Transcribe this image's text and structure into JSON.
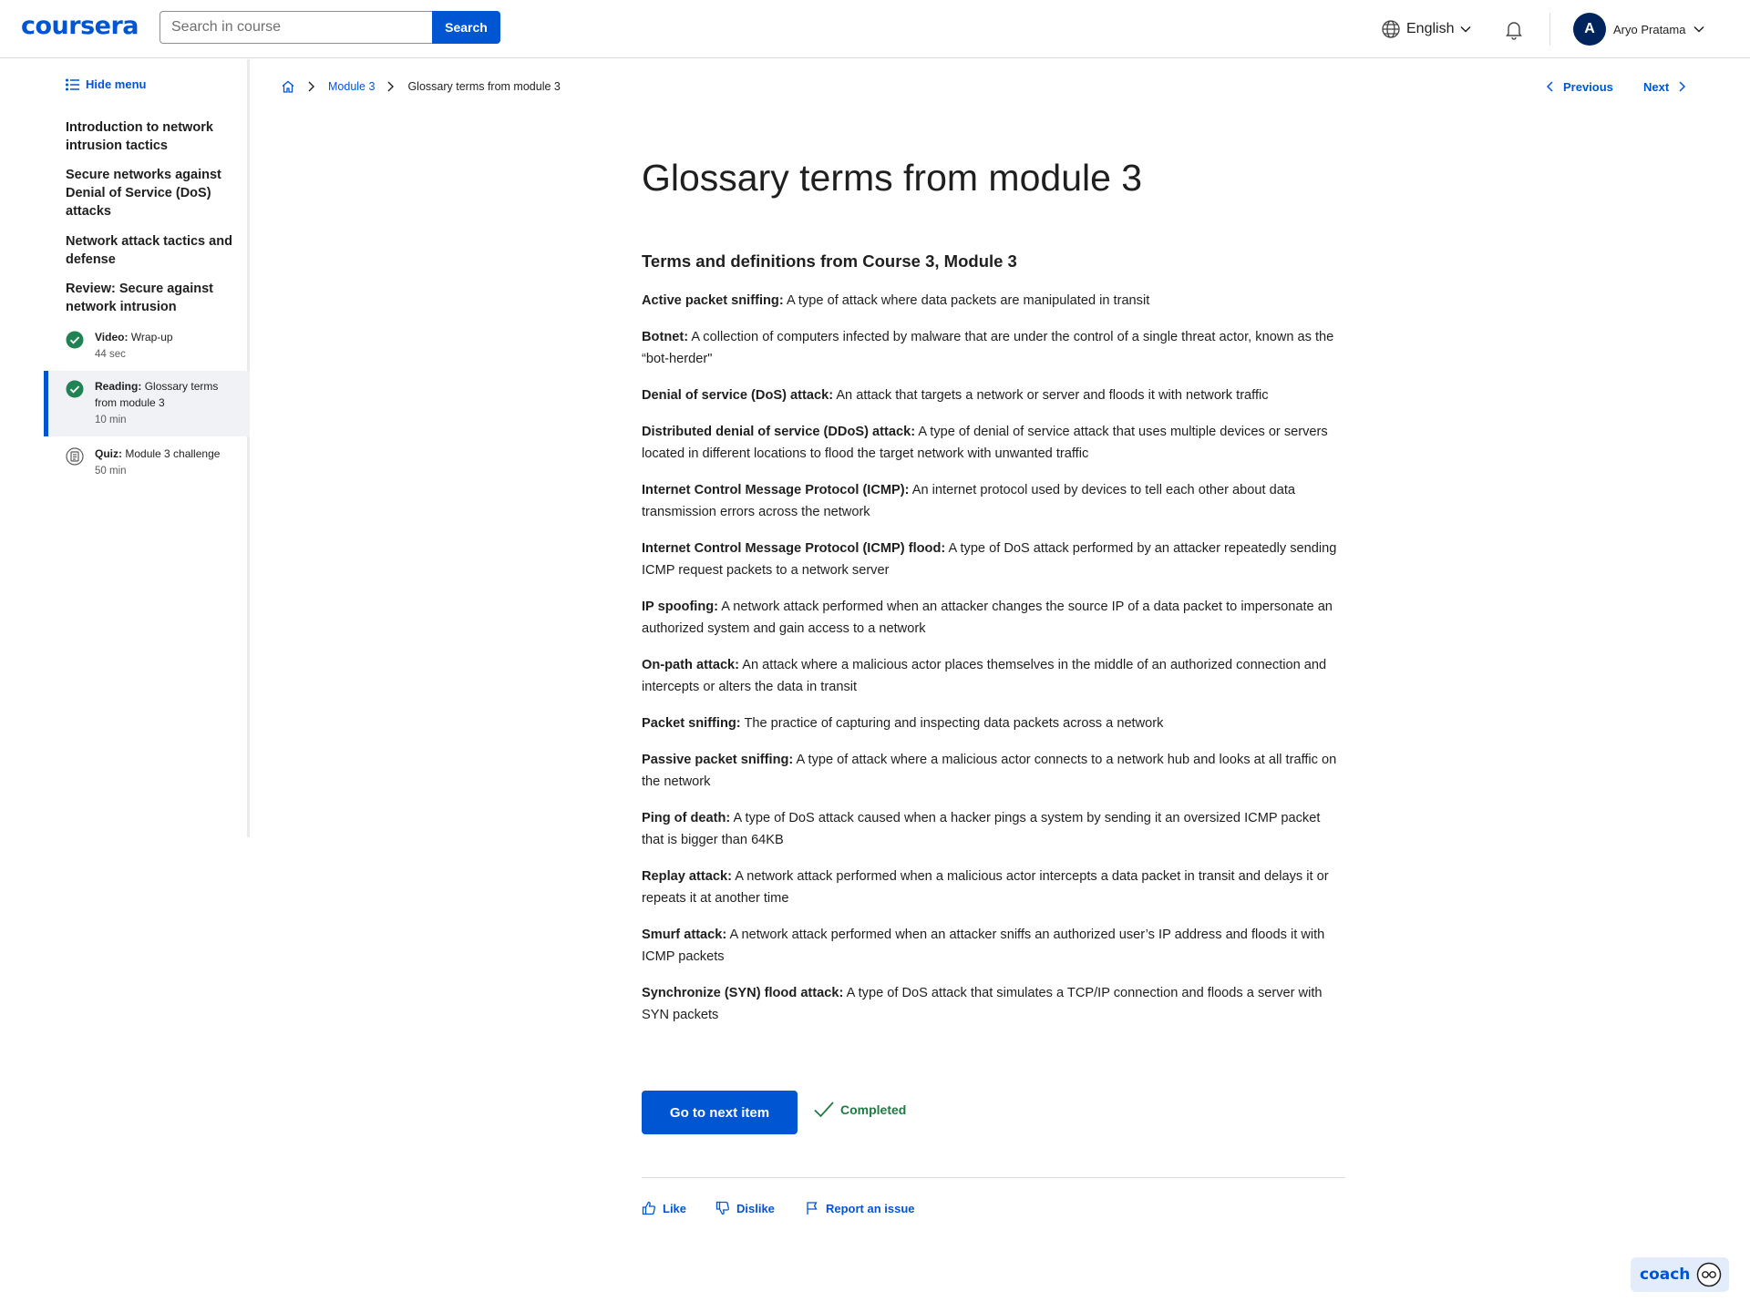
{
  "header": {
    "logo": "coursera",
    "search_placeholder": "Search in course",
    "search_button": "Search",
    "language": "English",
    "user_initial": "A",
    "user_name": "Aryo Pratama"
  },
  "sidebar": {
    "hide_menu": "Hide menu",
    "sections": [
      "Introduction to network intrusion tactics",
      "Secure networks against Denial of Service (DoS) attacks",
      "Network attack tactics and defense",
      "Review: Secure against network intrusion"
    ],
    "items": [
      {
        "type": "Video:",
        "title": "Wrap-up",
        "duration": "44 sec",
        "status": "completed"
      },
      {
        "type": "Reading:",
        "title": "Glossary terms from module 3",
        "duration": "10 min",
        "status": "completed"
      },
      {
        "type": "Quiz:",
        "title": "Module 3 challenge",
        "duration": "50 min",
        "status": "quiz"
      }
    ]
  },
  "breadcrumb": {
    "module": "Module 3",
    "current": "Glossary terms from module 3"
  },
  "nav": {
    "previous": "Previous",
    "next": "Next"
  },
  "main": {
    "title": "Glossary terms from module 3",
    "subtitle": "Terms and definitions from Course 3, Module 3",
    "terms": [
      {
        "term": "Active packet sniffing:",
        "def": "A type of attack where data packets are manipulated in transit"
      },
      {
        "term": "Botnet:",
        "def": "A collection of computers infected by malware that are under the control of a single threat actor, known as the “bot-herder\""
      },
      {
        "term": "Denial of service (DoS) attack:",
        "def": "An attack that targets a network or server and floods it with network traffic"
      },
      {
        "term": "Distributed denial of service (DDoS) attack:",
        "def": "A type of denial of service attack that uses multiple devices or servers located in different locations to flood the target network with unwanted traffic"
      },
      {
        "term": "Internet Control Message Protocol (ICMP):",
        "def": "An internet protocol used by devices to tell each other about data transmission errors across the network"
      },
      {
        "term": "Internet Control Message Protocol (ICMP) flood:",
        "def": "A type of DoS attack performed by an attacker repeatedly sending ICMP request packets to a network server"
      },
      {
        "term": "IP spoofing:",
        "def": "A network attack performed when an attacker changes the source IP of a data packet to impersonate an authorized system and gain access to a network"
      },
      {
        "term": "On-path attack:",
        "def": "An attack where a malicious actor places themselves in the middle of an authorized connection and intercepts or alters the data in transit"
      },
      {
        "term": "Packet sniffing:",
        "def": "The practice of capturing and inspecting data packets across a network"
      },
      {
        "term": "Passive packet sniffing:",
        "def": "A type of attack where a malicious actor connects to a network hub and looks at all traffic on the network"
      },
      {
        "term": "Ping of death:",
        "def": "A type of DoS attack caused when a hacker pings a system by sending it an oversized ICMP packet that is bigger than 64KB"
      },
      {
        "term": "Replay attack:",
        "def": "A network attack performed when a malicious actor intercepts a data packet in transit and delays it or repeats it at another time"
      },
      {
        "term": "Smurf attack:",
        "def": "A network attack performed when an attacker sniffs an authorized user’s IP address and floods it with ICMP packets"
      },
      {
        "term": "Synchronize (SYN) flood attack:",
        "def": "A type of DoS attack that simulates a TCP/IP connection and floods a server with SYN packets"
      }
    ],
    "next_button": "Go to next item",
    "completed": "Completed"
  },
  "feedback": {
    "like": "Like",
    "dislike": "Dislike",
    "report": "Report an issue"
  },
  "coach": "coach",
  "colors": {
    "brand": "#0056d2",
    "success": "#1f7a44",
    "text": "#1f1f1f"
  }
}
